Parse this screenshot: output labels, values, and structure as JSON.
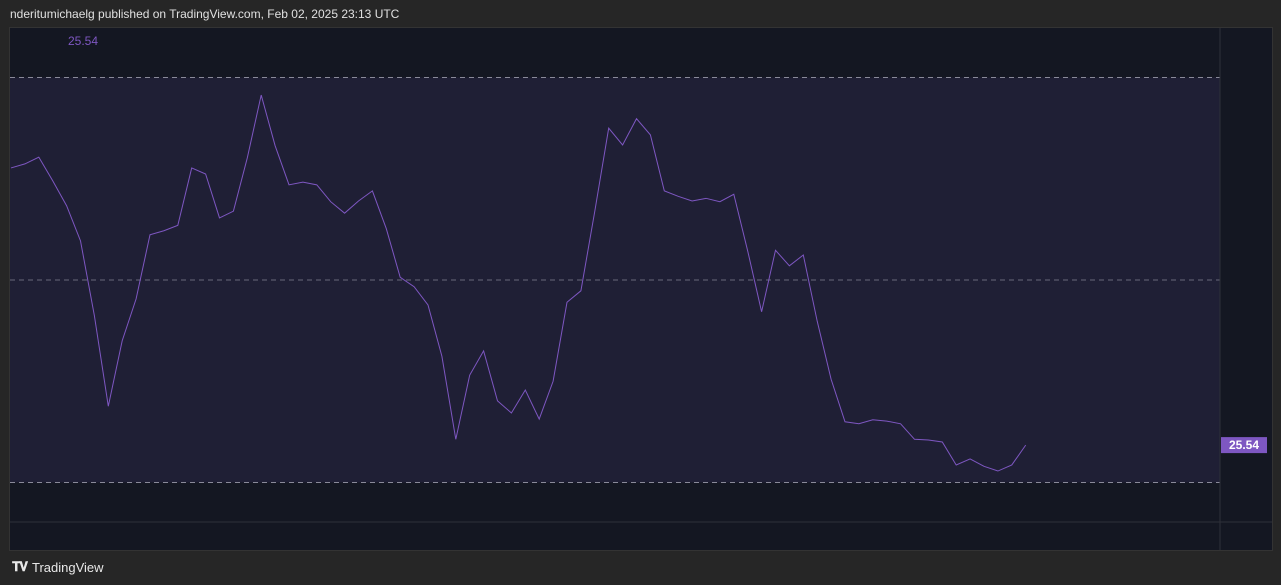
{
  "header": {
    "published": "nderitumichaelg published on TradingView.com, Feb 02, 2025 23:13 UTC"
  },
  "footer": {
    "brand": "TradingView",
    "logo_text": "TV"
  },
  "colors": {
    "line": "#7e57c2",
    "band": "#1f1f35",
    "label_bg": "#7e57c2"
  },
  "chart_data": {
    "type": "line",
    "legend_value": "25.54",
    "last_value_label": "25.54",
    "levels": {
      "upper": 80,
      "middle": 50,
      "lower": 20
    },
    "ylim": [
      13.5,
      87.5
    ],
    "values": [
      66.6,
      67.2,
      68.2,
      64.7,
      61.0,
      55.8,
      44.7,
      31.3,
      41.0,
      47.2,
      56.7,
      57.3,
      58.1,
      66.6,
      65.7,
      59.2,
      60.2,
      68.1,
      77.4,
      69.9,
      64.1,
      64.5,
      64.1,
      61.6,
      59.9,
      61.7,
      63.2,
      57.6,
      50.4,
      49.0,
      46.3,
      38.7,
      26.4,
      35.9,
      39.5,
      32.1,
      30.3,
      33.7,
      29.4,
      35.0,
      46.7,
      48.4,
      60.2,
      72.5,
      70.0,
      73.9,
      71.5,
      63.2,
      62.4,
      61.7,
      62.1,
      61.6,
      62.7,
      54.3,
      45.3,
      54.4,
      52.1,
      53.7,
      43.9,
      35.3,
      29.0,
      28.7,
      29.3,
      29.1,
      28.7,
      26.4,
      26.3,
      26.0,
      22.6,
      23.5,
      22.4,
      21.7,
      22.6,
      25.54
    ]
  }
}
